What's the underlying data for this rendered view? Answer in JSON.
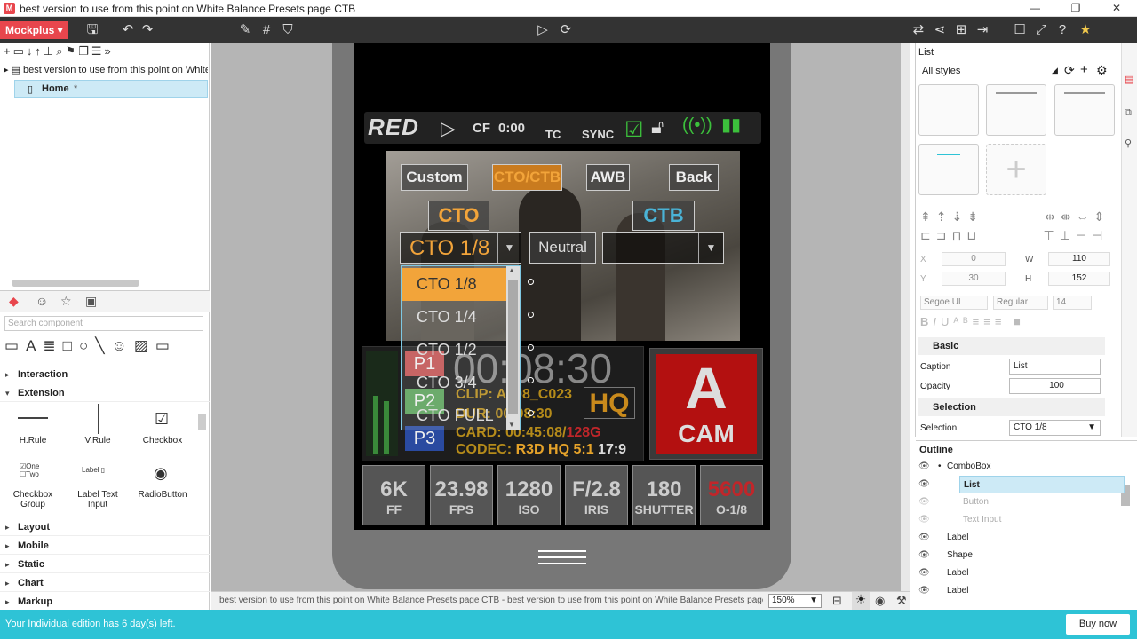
{
  "window": {
    "title": "best version to use from this point on White Balance Presets page CTB"
  },
  "toolbar": {
    "brand": "Mockplus ▾"
  },
  "project": {
    "root_label": "best version to use from this point on White B",
    "home_label": "Home",
    "home_marker": "*"
  },
  "components": {
    "search_placeholder": "Search component",
    "categories": [
      "Interaction",
      "Extension",
      "Layout",
      "Mobile",
      "Static",
      "Chart",
      "Markup"
    ],
    "items": [
      "H.Rule",
      "V.Rule",
      "Checkbox",
      "Checkbox Group",
      "Label Text Input",
      "RadioButton"
    ],
    "checkbox_group": {
      "one": "One",
      "two": "Two"
    },
    "label_text": "Label"
  },
  "red": {
    "logo": "RED",
    "cf": "CF",
    "time": "0:00",
    "tc": "TC",
    "sync": "SYNC",
    "buttons": [
      "Custom",
      "CTO/CTB",
      "AWB",
      "Back"
    ],
    "cto": "CTO",
    "ctb": "CTB",
    "combo_value": "CTO 1/8",
    "neutral": "Neutral",
    "list": [
      "CTO 1/8",
      "CTO 1/4",
      "CTO 1/2",
      "CTO 3/4",
      "CTO FULL"
    ],
    "presets": [
      "P1",
      "P2",
      "P3"
    ],
    "timecode": "00:08:30",
    "clip": "CLIP: A008_C023",
    "dur": "DUR: 00:08:30",
    "card_label": "CARD: 00:45:08/",
    "card_total": "128G",
    "codec_label": "CODEC: ",
    "codec_value": "R3D HQ 5:1",
    "codec_ratio": "17:9",
    "hq": "HQ",
    "cam_letter": "A",
    "cam_label": "CAM",
    "tiles": [
      {
        "big": "6K",
        "small": "FF"
      },
      {
        "big": "23.98",
        "small": "FPS"
      },
      {
        "big": "1280",
        "small": "ISO"
      },
      {
        "big": "F/2.8",
        "small": "IRIS"
      },
      {
        "big": "180",
        "small": "SHUTTER"
      },
      {
        "big": "5600",
        "small": "O-1/8"
      }
    ]
  },
  "statusbar": {
    "path": "best version to use from this point on White Balance Presets page CTB - best version to use from this point on White Balance Presets page CTB - Home [",
    "zoom": "150%"
  },
  "inspector": {
    "selected": "List",
    "styles": "All styles",
    "x": "0",
    "y": "30",
    "w": "110",
    "h": "152",
    "font": "Segoe UI",
    "weight": "Regular",
    "size": "14",
    "basic": "Basic",
    "caption_label": "Caption",
    "caption_value": "List",
    "opacity_label": "Opacity",
    "opacity_value": "100",
    "selection_section": "Selection",
    "selection_label": "Selection",
    "selection_value": "CTO 1/8"
  },
  "outline": {
    "title": "Outline",
    "rows": [
      {
        "label": "ComboBox",
        "indent": 1,
        "dim": false,
        "selected": false
      },
      {
        "label": "List",
        "indent": 2,
        "dim": false,
        "selected": true
      },
      {
        "label": "Button",
        "indent": 2,
        "dim": true,
        "selected": false
      },
      {
        "label": "Text Input",
        "indent": 2,
        "dim": true,
        "selected": false
      },
      {
        "label": "Label",
        "indent": 0,
        "dim": false,
        "selected": false
      },
      {
        "label": "Shape",
        "indent": 0,
        "dim": false,
        "selected": false
      },
      {
        "label": "Label",
        "indent": 0,
        "dim": false,
        "selected": false
      },
      {
        "label": "Label",
        "indent": 0,
        "dim": false,
        "selected": false
      }
    ]
  },
  "footer": {
    "trial_message": "Your Individual edition has 6 day(s) left.",
    "buy": "Buy now"
  },
  "colors": {
    "accent": "#e8464d",
    "teal": "#2ec3d6",
    "orange": "#f2a43a",
    "red_cam": "#b31010"
  }
}
